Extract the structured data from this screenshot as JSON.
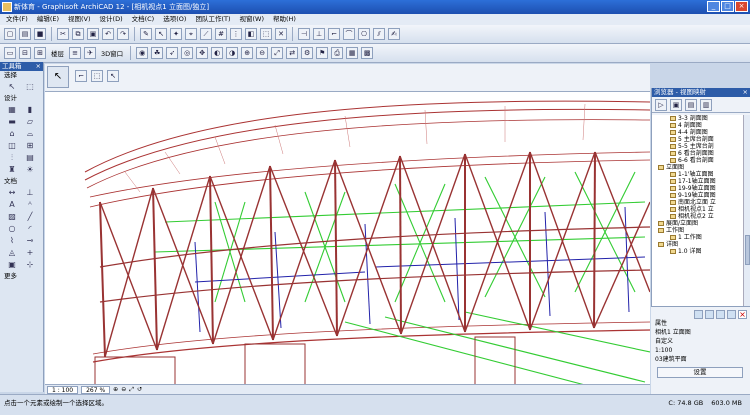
{
  "window": {
    "title": "新体育 - Graphisoft ArchiCAD 12 - [相机视点1 立面图/独立]",
    "minimize": "_",
    "restore": "□",
    "close": "×"
  },
  "menu": [
    "文件(F)",
    "编辑(E)",
    "视图(V)",
    "设计(D)",
    "文档(C)",
    "选项(O)",
    "团队工作(T)",
    "视窗(W)",
    "帮助(H)"
  ],
  "toolbar2": {
    "floor_label": "楼层",
    "view3d_label": "3D窗口"
  },
  "toolbox": {
    "title": "工具箱",
    "select_label": "选择",
    "design_label": "设计",
    "document_label": "文档",
    "more_label": "更多"
  },
  "infobox": {
    "arrow_label": "▶"
  },
  "scrollbar": {
    "scale": "1 : 100",
    "zoom": "267 %"
  },
  "status": {
    "message": "点击一个元素或绘制一个选择区域。",
    "disk": "C: 74.8 GB",
    "memory": "603.0 MB"
  },
  "navigator": {
    "title": "浏览器 - 视图映射",
    "items": [
      {
        "label": "3-3 剖面图",
        "indent": 3
      },
      {
        "label": "4 剖面图",
        "indent": 3
      },
      {
        "label": "4-4 剖面图",
        "indent": 3
      },
      {
        "label": "5 主席台剖面",
        "indent": 3
      },
      {
        "label": "5-5 主席台剖",
        "indent": 3
      },
      {
        "label": "6 看台剖面图",
        "indent": 3
      },
      {
        "label": "6-6 看台剖面",
        "indent": 3
      },
      {
        "label": "立面图",
        "indent": 1
      },
      {
        "label": "1-1'轴立面图",
        "indent": 3
      },
      {
        "label": "17-1轴立面图",
        "indent": 3
      },
      {
        "label": "19-9轴立面图",
        "indent": 3
      },
      {
        "label": "9-19轴立面图",
        "indent": 3
      },
      {
        "label": "南面北立面 立",
        "indent": 3
      },
      {
        "label": "相机视点1 立",
        "indent": 3
      },
      {
        "label": "相机视点2 立",
        "indent": 3
      },
      {
        "label": "展面/立面图",
        "indent": 1
      },
      {
        "label": "工作图",
        "indent": 1
      },
      {
        "label": "1 工作图",
        "indent": 3
      },
      {
        "label": "详图",
        "indent": 1
      },
      {
        "label": "1.0 详图",
        "indent": 3
      }
    ]
  },
  "properties": {
    "header": "属性",
    "view_name": "相机1 立面图",
    "custom": "自定义",
    "scale": "1:100",
    "layer": "03建筑平面",
    "settings_button": "设置"
  }
}
